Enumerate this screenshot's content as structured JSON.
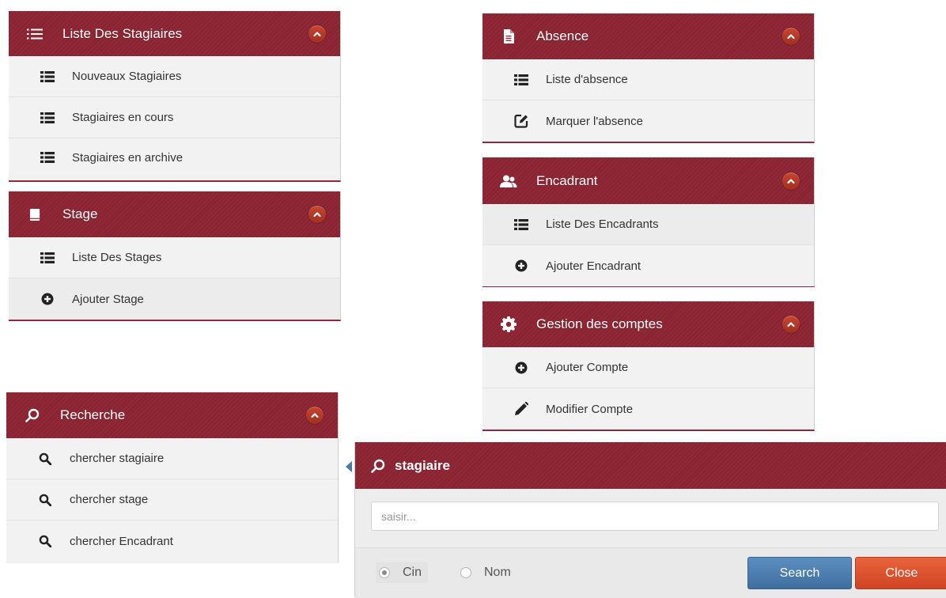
{
  "colors": {
    "header_bg": "#8a2332",
    "collapse_btn": "#b43a2a",
    "item_bg": "#f2f2f2",
    "search_btn": "#4a7db0",
    "close_btn": "#dd5530"
  },
  "panels": {
    "stagiaires": {
      "title": "Liste Des Stagiaires",
      "icon": "list-icon",
      "items": [
        {
          "label": "Nouveaux Stagiaires",
          "icon": "list-icon"
        },
        {
          "label": "Stagiaires en cours",
          "icon": "list-icon"
        },
        {
          "label": "Stagiaires en archive",
          "icon": "list-icon"
        }
      ]
    },
    "stage": {
      "title": "Stage",
      "icon": "book-icon",
      "items": [
        {
          "label": "Liste Des Stages",
          "icon": "list-icon"
        },
        {
          "label": "Ajouter Stage",
          "icon": "plus-circle-icon"
        }
      ]
    },
    "recherche": {
      "title": "Recherche",
      "icon": "search-icon",
      "items": [
        {
          "label": "chercher stagiaire",
          "icon": "search-icon"
        },
        {
          "label": "chercher stage",
          "icon": "search-icon"
        },
        {
          "label": "chercher Encadrant",
          "icon": "search-icon"
        }
      ]
    },
    "absence": {
      "title": "Absence",
      "icon": "document-icon",
      "items": [
        {
          "label": "Liste d'absence",
          "icon": "list-icon"
        },
        {
          "label": "Marquer l'absence",
          "icon": "edit-icon"
        }
      ]
    },
    "encadrant": {
      "title": "Encadrant",
      "icon": "users-icon",
      "items": [
        {
          "label": "Liste Des Encadrants",
          "icon": "list-icon"
        },
        {
          "label": "Ajouter Encadrant",
          "icon": "plus-circle-icon"
        }
      ]
    },
    "comptes": {
      "title": "Gestion des comptes",
      "icon": "gear-icon",
      "items": [
        {
          "label": "Ajouter Compte",
          "icon": "plus-circle-icon"
        },
        {
          "label": "Modifier Compte",
          "icon": "pencil-icon"
        }
      ]
    }
  },
  "search_popup": {
    "title": "stagiaire",
    "input_placeholder": "saisir...",
    "input_value": "",
    "radio_cin": "Cin",
    "radio_nom": "Nom",
    "radio_selected": "Cin",
    "search_label": "Search",
    "close_label": "Close"
  }
}
